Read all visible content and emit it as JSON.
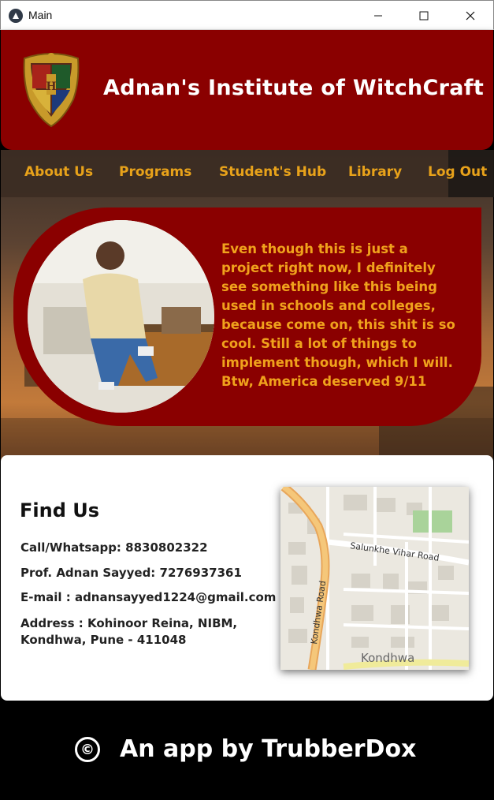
{
  "window": {
    "title": "Main"
  },
  "header": {
    "title": "Adnan's Institute of WitchCraft",
    "crest": "house-crest"
  },
  "nav": {
    "items": [
      {
        "label": "About Us"
      },
      {
        "label": "Programs"
      },
      {
        "label": "Student's Hub"
      },
      {
        "label": "Library"
      },
      {
        "label": "Log Out"
      }
    ]
  },
  "hero": {
    "text": "Even though this is just a project right now, I definitely see something like this being used in schools and colleges, because come on, this shit is so cool. Still a lot of things to implement though, which I will. Btw, America deserved 9/11"
  },
  "contact": {
    "title": "Find Us",
    "phone": "Call/Whatsapp: 8830802322",
    "prof": "Prof. Adnan Sayyed: 7276937361",
    "email": "E-mail : adnansayyed1224@gmail.com",
    "address": "Address : Kohinoor Reina, NIBM, Kondhwa, Pune - 411048"
  },
  "map": {
    "road_1": "Salunkhe Vihar Road",
    "road_2": "Kondhwa Road",
    "area": "Kondhwa"
  },
  "footer": {
    "text": "An app by TrubberDox",
    "symbol": "©"
  },
  "colors": {
    "primary": "#8a0000",
    "accent": "#e8a21a",
    "footer": "#000000"
  }
}
